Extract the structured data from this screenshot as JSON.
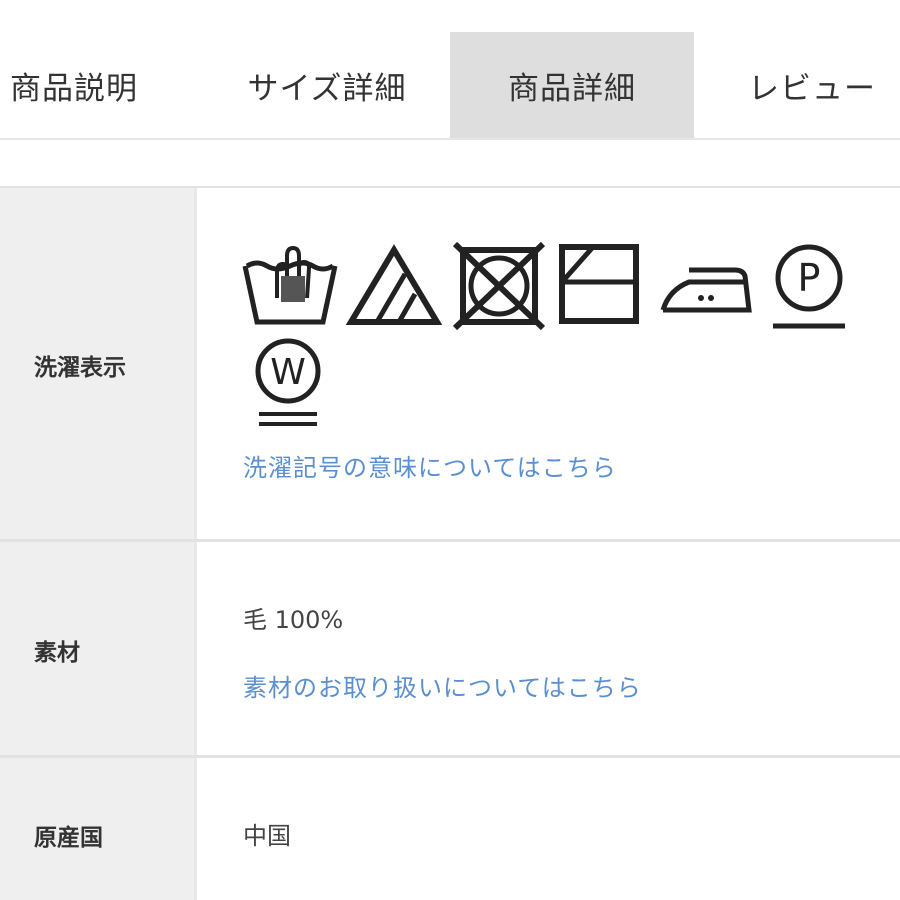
{
  "tabs": [
    {
      "label": "商品説明",
      "active": false
    },
    {
      "label": "サイズ詳細",
      "active": false
    },
    {
      "label": "商品詳細",
      "active": true
    },
    {
      "label": "レビュー",
      "active": false
    }
  ],
  "rows": {
    "care": {
      "label": "洗濯表示",
      "symbols": [
        "hand-wash-icon",
        "bleach-triangle-icon",
        "no-tumble-dry-icon",
        "line-dry-shade-icon",
        "iron-low-icon",
        "dry-clean-p-icon",
        "wet-clean-w-icon"
      ],
      "link": "洗濯記号の意味についてはこちら"
    },
    "material": {
      "label": "素材",
      "value": "毛 100%",
      "link": "素材のお取り扱いについてはこちら"
    },
    "origin": {
      "label": "原産国",
      "value": "中国"
    }
  },
  "colors": {
    "link": "#5a8fd0",
    "label_bg": "#efefef",
    "active_tab_bg": "#dedede"
  }
}
